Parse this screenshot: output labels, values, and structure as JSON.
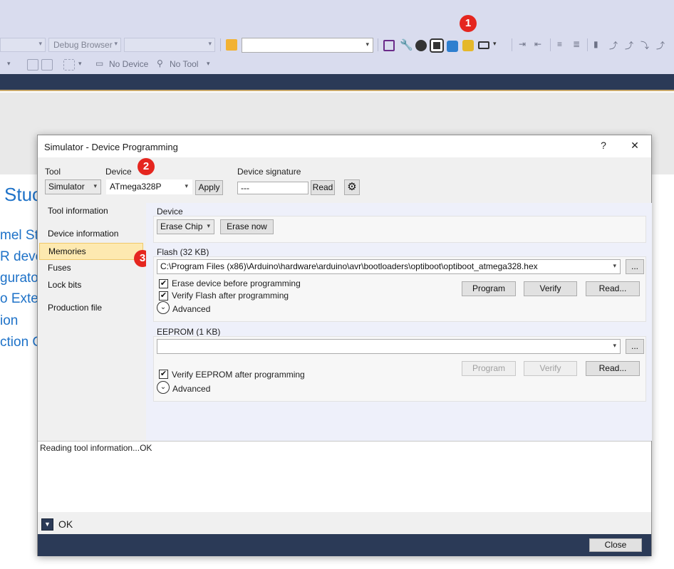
{
  "toolbar": {
    "combo1_arrow": "▾",
    "debug_browser_label": "Debug Browser",
    "no_device_label": "No Device",
    "no_tool_label": "No Tool"
  },
  "background": {
    "start_page_lines": [
      "Stuc",
      "mel Stu",
      "R deve",
      "gurato",
      "o Exten",
      "ion",
      "ction C"
    ]
  },
  "annotations": {
    "badge1": "1",
    "badge2": "2",
    "badge3": "3"
  },
  "dialog": {
    "title": "Simulator - Device Programming",
    "help_label": "?",
    "close_label": "✕",
    "tool_label": "Tool",
    "tool_value": "Simulator",
    "device_label": "Device",
    "device_value": "ATmega328P",
    "apply_label": "Apply",
    "signature_label": "Device signature",
    "signature_value": "---",
    "read_label": "Read",
    "nav": [
      "Tool information",
      "Device information",
      "Memories",
      "Fuses",
      "Lock bits",
      "Production file"
    ],
    "nav_selected_index": 2,
    "device_group": {
      "title": "Device",
      "erase_combo": "Erase Chip",
      "erase_now": "Erase now"
    },
    "flash_group": {
      "title": "Flash (32 KB)",
      "path": "C:\\Program Files (x86)\\Arduino\\hardware\\arduino\\avr\\bootloaders\\optiboot\\optiboot_atmega328.hex",
      "browse": "...",
      "erase_before": "Erase device before programming",
      "verify_after": "Verify Flash after programming",
      "advanced": "Advanced",
      "program": "Program",
      "verify": "Verify",
      "read": "Read..."
    },
    "eeprom_group": {
      "title": "EEPROM (1 KB)",
      "path": "",
      "browse": "...",
      "verify_after": "Verify EEPROM after programming",
      "advanced": "Advanced",
      "program": "Program",
      "verify": "Verify",
      "read": "Read..."
    },
    "log_text": "Reading tool information...OK",
    "status_text": "OK",
    "close_button": "Close"
  }
}
